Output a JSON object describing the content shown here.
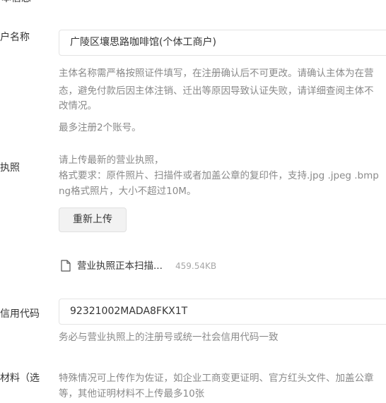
{
  "form": {
    "section_label_partial": "本信息",
    "merchant_name": {
      "label": "户名称",
      "value": "广陵区壤思路咖啡馆(个体工商户)",
      "help_lines": [
        "主体名称需严格按照证件填写，在注册确认后不可更改。请确认主体为在营",
        "态，避免付款后因主体注销、迁出等原因导致认证失败，请详细查阅主体不",
        "改情况。"
      ],
      "limit_note": "最多注册2个账号。"
    },
    "business_license": {
      "label": "执照",
      "instructions": [
        "请上传最新的营业执照，",
        "格式要求：原件照片、扫描件或者加盖公章的复印件，支持.jpg .jpeg .bmp",
        "ng格式照片，大小不超过10M。"
      ],
      "reupload_button": "重新上传",
      "file": {
        "icon": "file-icon",
        "name": "营业执照正本扫描...",
        "size": "459.54KB"
      }
    },
    "credit_code": {
      "label": "信用代码",
      "value": "92321002MADA8FKX1T",
      "help": "务必与营业执照上的注册号或统一社会信用代码一致"
    },
    "supplementary": {
      "label": "材料（选",
      "help_lines": [
        "特殊情况可上传作为佐证，如企业工商变更证明、官方红头文件、加盖公章",
        "等，其他证明材料不上传最多10张"
      ]
    }
  }
}
